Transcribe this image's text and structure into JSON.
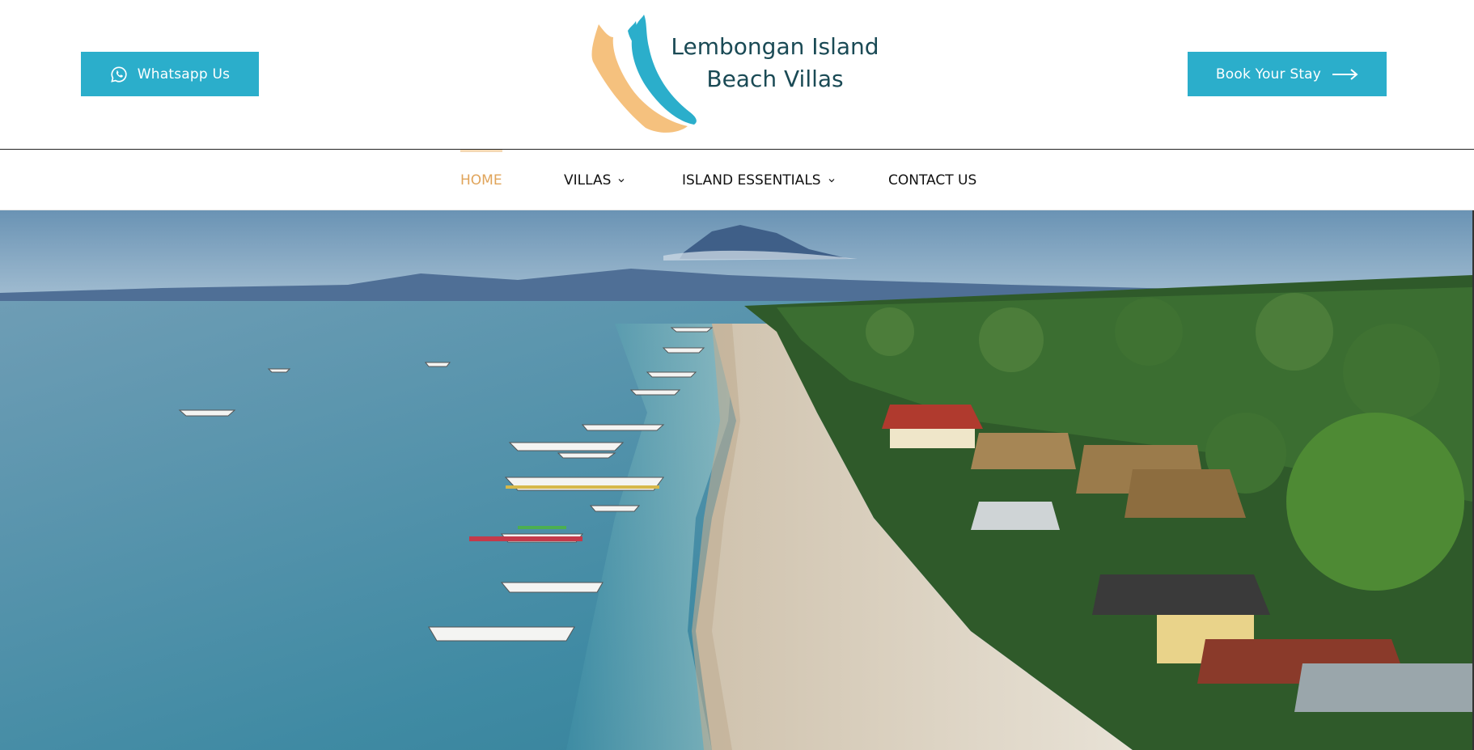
{
  "header": {
    "whatsapp_label": "Whatsapp Us",
    "book_label": "Book Your Stay",
    "logo_line1": "Lembongan Island",
    "logo_line2": "Beach Villas"
  },
  "nav": {
    "items": [
      {
        "label": "HOME",
        "active": true,
        "has_dropdown": false
      },
      {
        "label": "VILLAS",
        "active": false,
        "has_dropdown": true
      },
      {
        "label": "ISLAND ESSENTIALS",
        "active": false,
        "has_dropdown": true
      },
      {
        "label": "CONTACT US",
        "active": false,
        "has_dropdown": false
      }
    ]
  },
  "colors": {
    "accent": "#2baecb",
    "active_nav": "#e0a45a",
    "logo_text": "#1a4a55",
    "logo_orange": "#f5c17e",
    "logo_blue": "#2baecb"
  },
  "icons": {
    "whatsapp": "whatsapp-icon",
    "book_arrow": "arrow-right-icon",
    "dropdown": "chevron-down-icon"
  },
  "hero": {
    "scene": "aerial view of beach with boats, palm trees and mountain"
  }
}
